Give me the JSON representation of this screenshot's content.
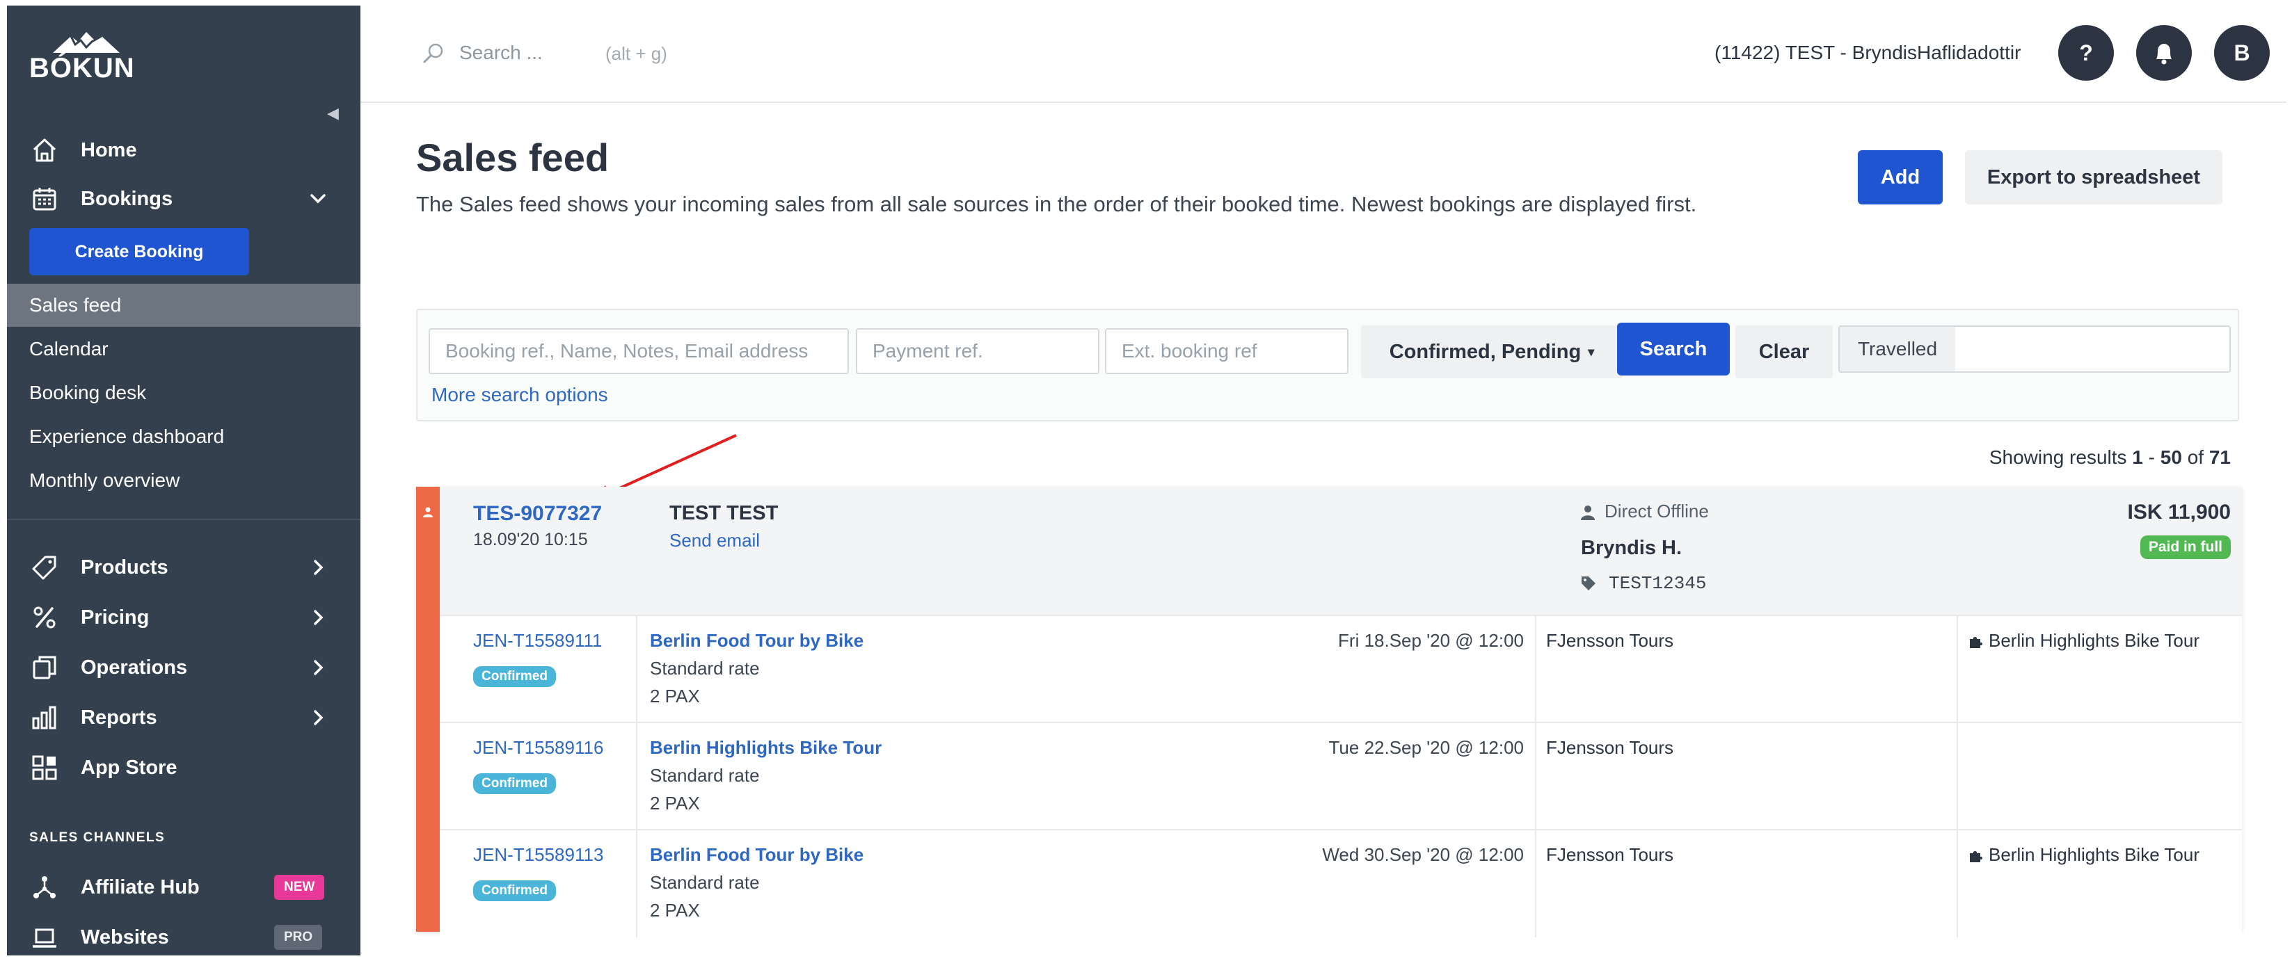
{
  "app": {
    "logo": "BÓKUN"
  },
  "sidebar": {
    "home": "Home",
    "bookings": "Bookings",
    "create_booking": "Create Booking",
    "sub_items": [
      "Sales feed",
      "Calendar",
      "Booking desk",
      "Experience dashboard",
      "Monthly overview"
    ],
    "active_sub": "Sales feed",
    "products": "Products",
    "pricing": "Pricing",
    "operations": "Operations",
    "reports": "Reports",
    "app_store": "App Store",
    "section_sales_channels": "SALES CHANNELS",
    "affiliate_hub": "Affiliate Hub",
    "affiliate_badge": "NEW",
    "websites": "Websites",
    "websites_badge": "PRO"
  },
  "topbar": {
    "search_placeholder": "Search ...",
    "search_hint": "(alt + g)",
    "account": "(11422) TEST - BryndisHaflidadottir",
    "help": "?",
    "avatar": "B"
  },
  "page": {
    "title": "Sales feed",
    "description": "The Sales feed shows your incoming sales from all sale sources in the order of their booked time. Newest bookings are displayed first.",
    "add": "Add",
    "export": "Export to spreadsheet"
  },
  "filters": {
    "booking_ref_placeholder": "Booking ref., Name, Notes, Email address",
    "payment_ref_placeholder": "Payment ref.",
    "ext_ref_placeholder": "Ext. booking ref",
    "status": "Confirmed, Pending",
    "search": "Search",
    "clear": "Clear",
    "travelled": "Travelled",
    "more_options": "More search options"
  },
  "results": {
    "prefix": "Showing results",
    "from": "1",
    "sep": "-",
    "to": "50",
    "of": "of",
    "total": "71"
  },
  "booking": {
    "ref": "TES-9077327",
    "date": "18.09'20 10:15",
    "customer": "TEST TEST",
    "send_email": "Send email",
    "channel": "Direct Offline",
    "agent": "Bryndis H.",
    "tag": "TEST12345",
    "amount": "ISK 11,900",
    "payment_status": "Paid in full",
    "accent_color": "#ee6a47",
    "items": [
      {
        "ref": "JEN-T15589111",
        "status": "Confirmed",
        "product": "Berlin Food Tour by Bike",
        "rate": "Standard rate",
        "pax": "2 PAX",
        "date": "Fri 18.Sep '20 @ 12:00",
        "supplier": "FJensson Tours",
        "ext": "Berlin Highlights Bike Tour"
      },
      {
        "ref": "JEN-T15589116",
        "status": "Confirmed",
        "product": "Berlin Highlights Bike Tour",
        "rate": "Standard rate",
        "pax": "2 PAX",
        "date": "Tue 22.Sep '20 @ 12:00",
        "supplier": "FJensson Tours",
        "ext": ""
      },
      {
        "ref": "JEN-T15589113",
        "status": "Confirmed",
        "product": "Berlin Food Tour by Bike",
        "rate": "Standard rate",
        "pax": "2 PAX",
        "date": "Wed 30.Sep '20 @ 12:00",
        "supplier": "FJensson Tours",
        "ext": "Berlin Highlights Bike Tour"
      }
    ]
  },
  "colors": {
    "sidebar": "#34404d",
    "primary": "#1f55d0",
    "link": "#2f68c2",
    "confirmed": "#4bb4d9",
    "paid": "#52b852",
    "annotation_arrow": "#e02020"
  }
}
